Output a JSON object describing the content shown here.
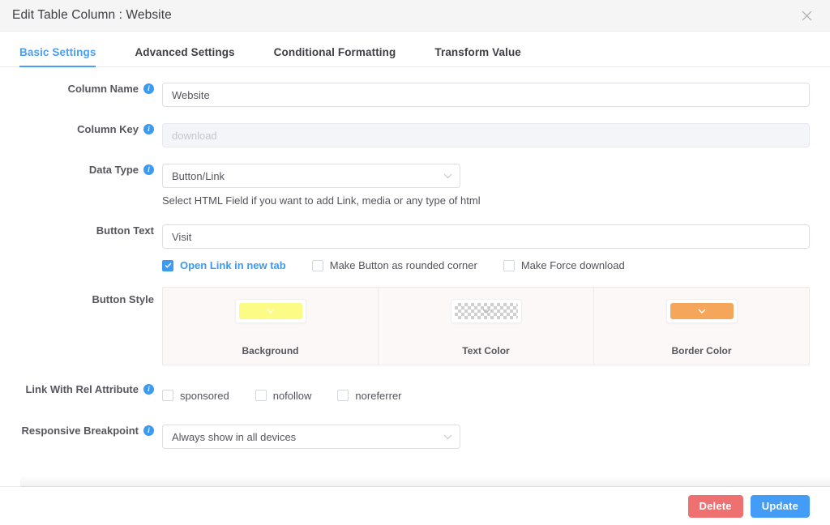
{
  "header": {
    "title": "Edit Table Column : Website",
    "close_icon": "close-icon"
  },
  "tabs": [
    {
      "label": "Basic Settings",
      "active": true
    },
    {
      "label": "Advanced Settings",
      "active": false
    },
    {
      "label": "Conditional Formatting",
      "active": false
    },
    {
      "label": "Transform Value",
      "active": false
    }
  ],
  "fields": {
    "column_name": {
      "label": "Column Name",
      "value": "Website",
      "info_icon": "info-icon"
    },
    "column_key": {
      "label": "Column Key",
      "value": "",
      "placeholder": "download",
      "info_icon": "info-icon"
    },
    "data_type": {
      "label": "Data Type",
      "value": "Button/Link",
      "info_icon": "info-icon",
      "chevron_icon": "chevron-down-icon",
      "helper": "Select HTML Field if you want to add Link, media or any type of html"
    },
    "button_text": {
      "label": "Button Text",
      "value": "Visit"
    },
    "button_options": [
      {
        "label": "Open Link in new tab",
        "checked": true
      },
      {
        "label": "Make Button as rounded corner",
        "checked": false
      },
      {
        "label": "Make Force download",
        "checked": false
      }
    ],
    "button_style": {
      "label": "Button Style",
      "cells": [
        {
          "caption": "Background",
          "color": "#fbfb86",
          "transparent": false,
          "chevron_icon": "chevron-down-icon"
        },
        {
          "caption": "Text Color",
          "color": "",
          "transparent": true,
          "chevron_icon": "chevron-down-icon"
        },
        {
          "caption": "Border Color",
          "color": "#f5a65a",
          "transparent": false,
          "chevron_icon": "chevron-down-icon"
        }
      ]
    },
    "rel_attribute": {
      "label": "Link With Rel Attribute",
      "info_icon": "info-icon",
      "options": [
        {
          "label": "sponsored",
          "checked": false
        },
        {
          "label": "nofollow",
          "checked": false
        },
        {
          "label": "noreferrer",
          "checked": false
        }
      ]
    },
    "responsive_breakpoint": {
      "label": "Responsive Breakpoint",
      "value": "Always show in all devices",
      "info_icon": "info-icon",
      "chevron_icon": "chevron-down-icon"
    }
  },
  "footer": {
    "delete_label": "Delete",
    "delete_color": "#ef7070",
    "update_label": "Update",
    "update_color": "#439cf5"
  }
}
